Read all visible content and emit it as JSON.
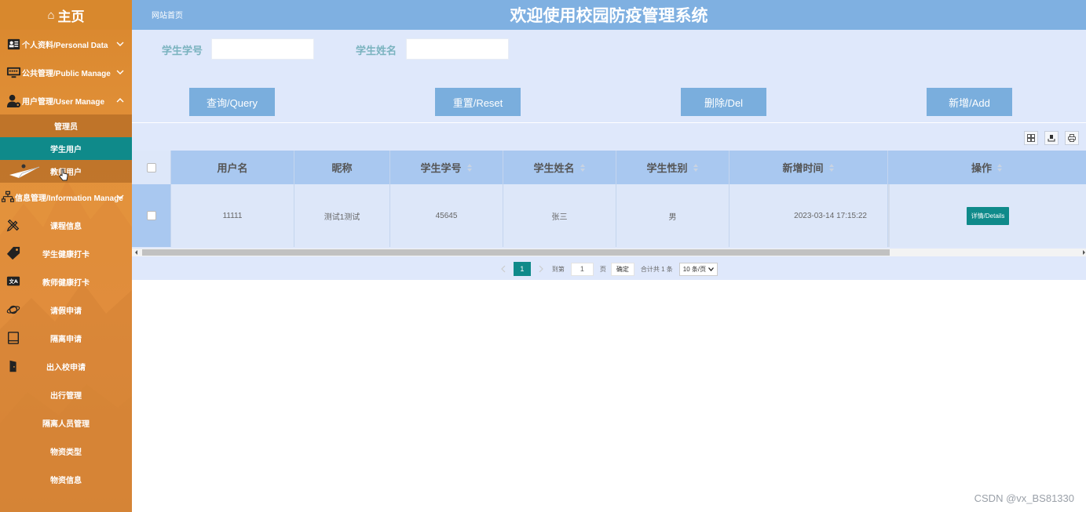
{
  "sidebar": {
    "home_label": "主页",
    "groups": [
      {
        "label": "个人资料/Personal Data",
        "icon": "user-card-icon"
      },
      {
        "label": "公共管理/Public Manage",
        "icon": "monitor-icon"
      },
      {
        "label": "用户管理/User Manage",
        "icon": "user-gear-icon"
      }
    ],
    "user_sub_items": [
      "管理员",
      "学生用户",
      "教师用户"
    ],
    "info_group": {
      "label": "信息管理/Information Manage",
      "icon": "sitemap-icon"
    },
    "info_items": [
      {
        "label": "课程信息",
        "icon": "pencil-ruler-icon"
      },
      {
        "label": "学生健康打卡",
        "icon": "tag-icon"
      },
      {
        "label": "教师健康打卡",
        "icon": "translate-icon"
      },
      {
        "label": "请假申请",
        "icon": "planet-icon"
      },
      {
        "label": "隔离申请",
        "icon": "book-icon"
      },
      {
        "label": "出入校申请",
        "icon": "door-icon"
      },
      {
        "label": "出行管理",
        "icon": ""
      },
      {
        "label": "隔离人员管理",
        "icon": ""
      },
      {
        "label": "物资类型",
        "icon": ""
      },
      {
        "label": "物资信息",
        "icon": ""
      }
    ]
  },
  "header": {
    "breadcrumb": "网站首页",
    "title": "欢迎使用校园防疫管理系统"
  },
  "search": {
    "student_no_label": "学生学号",
    "student_no_value": "",
    "student_name_label": "学生姓名",
    "student_name_value": "",
    "query_label": "查询/Query",
    "reset_label": "重置/Reset",
    "delete_label": "删除/Del",
    "add_label": "新增/Add"
  },
  "table": {
    "columns": [
      "用户名",
      "昵称",
      "学生学号",
      "学生姓名",
      "学生性别",
      "新增时间",
      "操作"
    ],
    "rows": [
      {
        "username": "11111",
        "nickname": "测试1测试",
        "student_no": "45645",
        "student_name": "张三",
        "gender": "男",
        "created": "2023-03-14 17:15:22",
        "action": "详情/Details"
      }
    ]
  },
  "pager": {
    "current_page": "1",
    "goto_label": "到第",
    "goto_value": "1",
    "page_unit": "页",
    "ok_label": "确定",
    "total_label": "合计共 1 条",
    "page_size": "10 条/页"
  },
  "watermark": "CSDN @vx_BS81330",
  "colors": {
    "sidebar": "#e2913a",
    "header": "#7fb0e1",
    "panel": "#dfe8fb",
    "button": "#7aaedd",
    "accent": "#0f8a8a",
    "label": "#7ab3bf"
  }
}
